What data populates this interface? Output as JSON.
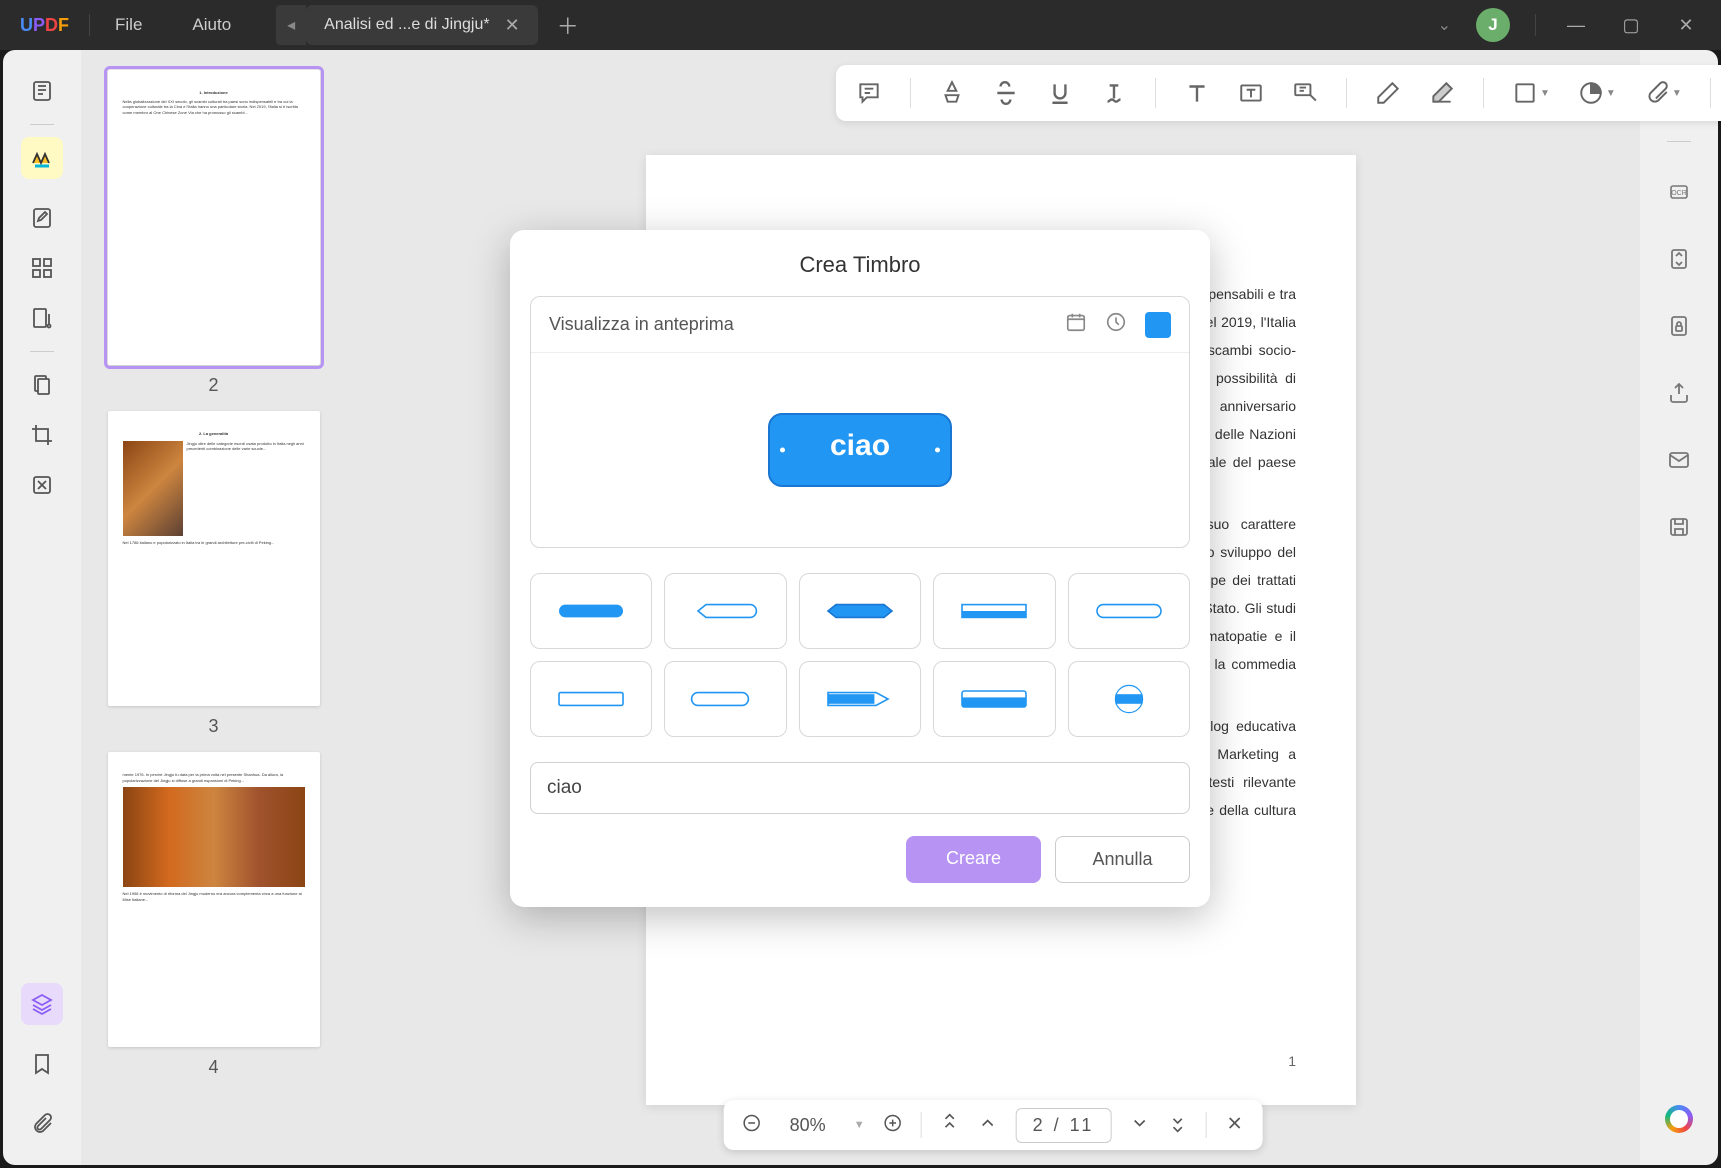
{
  "app": {
    "logo": "UPDF",
    "avatar_letter": "J"
  },
  "menu": {
    "file": "File",
    "help": "Aiuto"
  },
  "tab": {
    "title": "Analisi ed ...e di Jingju*"
  },
  "thumbnails": {
    "p2": "2",
    "p3": "3",
    "p4": "4"
  },
  "document": {
    "heading": "1. Introduzione",
    "para1": "Nella globalizzazione del XXI secolo, gli scambi culturali tra paesi sono indispensabili e tra cui la cooperazione culturale tra la Cina e l'Italia hanno una particolare storia. Nel 2019, l'Italia si è iscritta come membro al \"One Chinese Zone Via\", che ha promosso gli scambi socio-culturali tra le popolazioni europee e asiatiche; da molto tempo, la maggior possibilità di approfondimento spazziga nello sviluppo culturale. Il 2020 è il 50 ° anniversario dell'instaurazione delle relazioni diplomatiche tra la Cina e l'Italia e il bilinguismo delle Nazioni Unite. Nel 2022 anno della Cultura e dell'Arte Sinoitalia dell'esperienza generale del paese aperto, giudizioso alle culturali.",
    "para2": "Il cinismo, i costumi di ruolo stanziati nel Jingju costituiscono il suo carattere essenzialmente dell'Arte nazionale cinese. Il Jingju è definito sull'eredità e sullo sviluppo del tratto koreo, della tradi difendente senza limiti tramite comunicazioni tra le tappe dei trattati Giochi. Il Jingju è il ruolo conte nello sviluppo dell'istruzione generale del borie Stato. Gli studi approfonditi compiono utili di opporsi tra le aree di aree di tutti quelli drammatopatie e il costruttore dell'Italiano Warner dei grandi movimenti da conformano il Jingju e la commedia dell'Arte, trasprofondanti.",
    "para3": "Nell'articolo, l'analisi delle differenze e delle somiglianze tra le arti Monolog educativa cinele. Kansalis degli scambi precedenti e della diffusione orientata verso Marketing a potenziale sviluppo in China i lettori magistrano la cultura alle spalle da testi rilevante personaggi modi: specifici culturali. Spero di proporre tersameinte alla diffusione della cultura dell'arte teatro sempre ottimizzate più profondo che preghi non per nolo.",
    "page_num_corner": "1"
  },
  "modal": {
    "title": "Crea Timbro",
    "preview_label": "Visualizza in anteprima",
    "stamp_text": "ciao",
    "input_value": "ciao",
    "create_btn": "Creare",
    "cancel_btn": "Annulla"
  },
  "bottombar": {
    "zoom": "80%",
    "page": "2",
    "sep": "/",
    "total": "11"
  }
}
